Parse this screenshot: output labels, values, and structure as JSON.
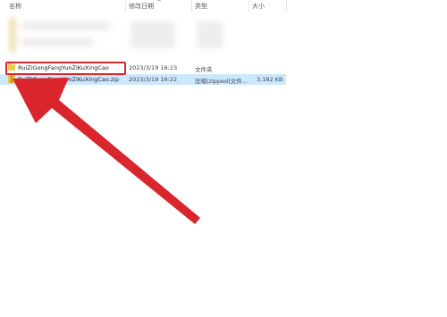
{
  "columns": {
    "name": "名称",
    "modified": "修改日期",
    "type": "类型",
    "size": "大小",
    "sort_indicator": "^"
  },
  "files": [
    {
      "icon": "folder-icon",
      "name": "RuiZiGongFangYunZiKuXingCao",
      "modified": "2023/3/19 16:23",
      "type": "文件夹",
      "size": "",
      "selected": false,
      "highlighted": true
    },
    {
      "icon": "zip-file-icon",
      "name": "RuiZiGongFangYunZiKuXingCao.zip",
      "modified": "2023/3/19 16:22",
      "type": "压缩(zipped)文件...",
      "size": "3,182 KB",
      "selected": true,
      "highlighted": false
    }
  ],
  "annotation": {
    "box_color": "#d9262d",
    "arrow_color": "#d9262d"
  },
  "colors": {
    "selection": "#cce8ff",
    "folder": "#f2c94c"
  }
}
